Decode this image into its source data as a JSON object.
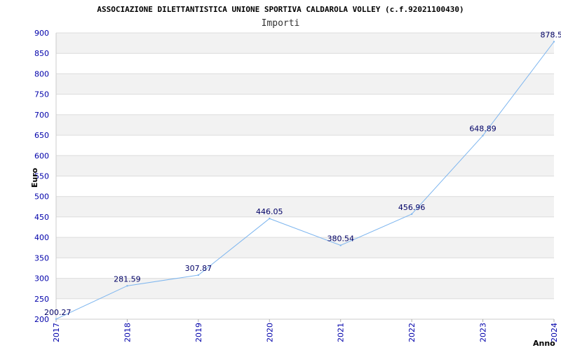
{
  "chart_data": {
    "type": "line",
    "title": "ASSOCIAZIONE DILETTANTISTICA UNIONE SPORTIVA CALDAROLA VOLLEY (c.f.92021100430)",
    "subtitle": "Importi",
    "xlabel": "Anno",
    "ylabel": "Euro",
    "categories": [
      "2017",
      "2018",
      "2019",
      "2020",
      "2021",
      "2022",
      "2023",
      "2024"
    ],
    "series": [
      {
        "values": [
          200.27,
          281.59,
          307.87,
          446.05,
          380.54,
          456.96,
          648.89,
          878.5
        ]
      }
    ],
    "data_labels": [
      "200.27",
      "281.59",
      "307.87",
      "446.05",
      "380.54",
      "456.96",
      "648.89",
      "878.5"
    ],
    "ylim": [
      200,
      900
    ],
    "yticks": [
      200,
      250,
      300,
      350,
      400,
      450,
      500,
      550,
      600,
      650,
      700,
      750,
      800,
      850,
      900
    ],
    "grid": true,
    "colors": {
      "line": "#7eb6ef",
      "band_alt": "#f2f2f2",
      "band": "#ffffff",
      "tick_text": "#0000aa",
      "label_text": "#000066",
      "grid_line": "#dcdcdc"
    }
  }
}
